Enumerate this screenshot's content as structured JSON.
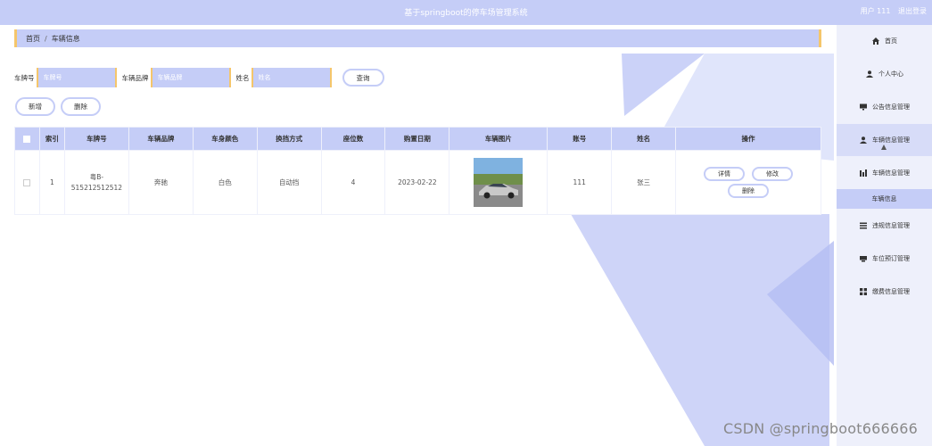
{
  "header": {
    "title": "基于springboot的停车场管理系统",
    "user_label": "用户 111",
    "logout": "退出登录"
  },
  "breadcrumb": {
    "home": "首页",
    "separator": "/",
    "current": "车辆信息"
  },
  "search": {
    "plate_label": "车牌号",
    "plate_placeholder": "车牌号",
    "brand_label": "车辆品牌",
    "brand_placeholder": "车辆品牌",
    "name_label": "姓名",
    "name_placeholder": "姓名",
    "search_button": "查询"
  },
  "actions": {
    "add": "新增",
    "delete": "删除"
  },
  "table": {
    "columns": [
      "索引",
      "车牌号",
      "车辆品牌",
      "车身颜色",
      "换挡方式",
      "座位数",
      "购置日期",
      "车辆图片",
      "账号",
      "姓名",
      "操作"
    ],
    "rows": [
      {
        "index": "1",
        "plate": "粤B-515212512512",
        "brand": "奔驰",
        "color": "白色",
        "gear": "自动挡",
        "seats": "4",
        "date": "2023-02-22",
        "account": "111",
        "name": "张三",
        "ops": {
          "detail": "详情",
          "edit": "修改",
          "delete": "删除"
        }
      }
    ]
  },
  "sidebar": {
    "items": [
      {
        "label": "首页",
        "icon": "home-icon"
      },
      {
        "label": "个人中心",
        "icon": "user-icon"
      },
      {
        "label": "公告信息管理",
        "icon": "monitor-icon"
      },
      {
        "label": "车辆信息管理",
        "icon": "user-icon"
      },
      {
        "label": "车辆信息管理",
        "icon": "bar-chart-icon"
      },
      {
        "label": "违规信息管理",
        "icon": "list-icon"
      },
      {
        "label": "车位预订管理",
        "icon": "card-icon"
      },
      {
        "label": "缴费信息管理",
        "icon": "grid-icon"
      }
    ],
    "submenu": "车辆信息"
  },
  "watermark": "CSDN @springboot666666",
  "colors": {
    "accent": "#c5cdf7",
    "border_accent": "#f5c66b",
    "sidebar_bg": "#eef0fb"
  }
}
